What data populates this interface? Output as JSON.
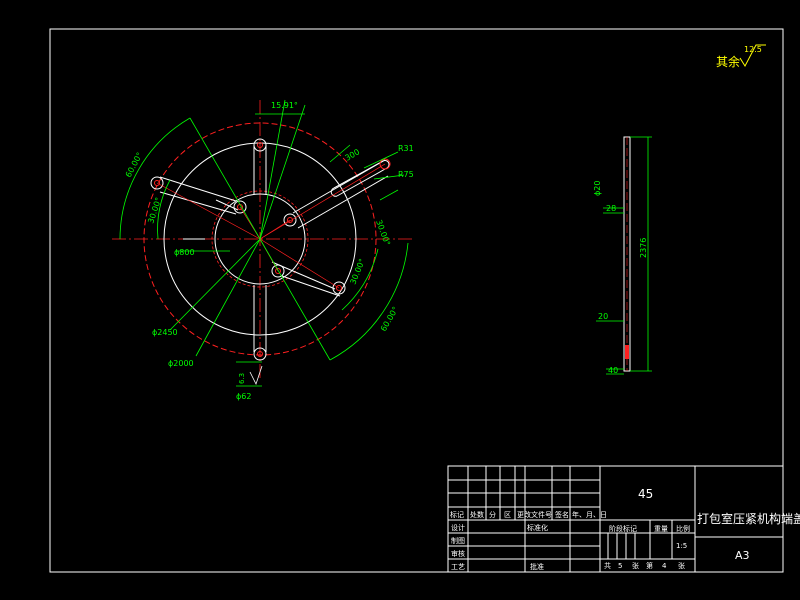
{
  "colors": {
    "background": "#000000",
    "frame": "#ffffff",
    "dimension": "#00ff00",
    "centerline": "#ff0000",
    "hidden": "#ff4040",
    "accent": "#ffff00"
  },
  "surface_finish": {
    "label": "其余",
    "value": "12.5"
  },
  "plan_view": {
    "angles": [
      "15.91°",
      "60.00°",
      "30.00°",
      "30.00°",
      "30.00°",
      "60.00°"
    ],
    "radius_labels": [
      "300",
      "R31",
      "R75"
    ],
    "diameters": [
      "ϕ800",
      "ϕ2450",
      "ϕ2000",
      "ϕ62"
    ],
    "roughness": "6.3"
  },
  "section_view": {
    "dims": [
      "ϕ20",
      "28",
      "2376",
      "20",
      "40"
    ]
  },
  "title_block": {
    "material": "45",
    "part_name": "打包室压紧机构端盖",
    "sheet_size": "A3",
    "scale": "1:5",
    "revision_headers": [
      "标记",
      "处数",
      "分",
      "区",
      "更改文件号",
      "签名",
      "年、月、日"
    ],
    "row_labels": {
      "design": "设计",
      "standardize": "标准化",
      "drawing": "制图",
      "review": "审核",
      "process": "工艺",
      "approve": "批准"
    },
    "stage_mark": "阶段标记",
    "weight": "重量",
    "scale_label": "比例",
    "sheets": [
      "共",
      "5",
      "张",
      "第",
      "4",
      "张"
    ]
  }
}
